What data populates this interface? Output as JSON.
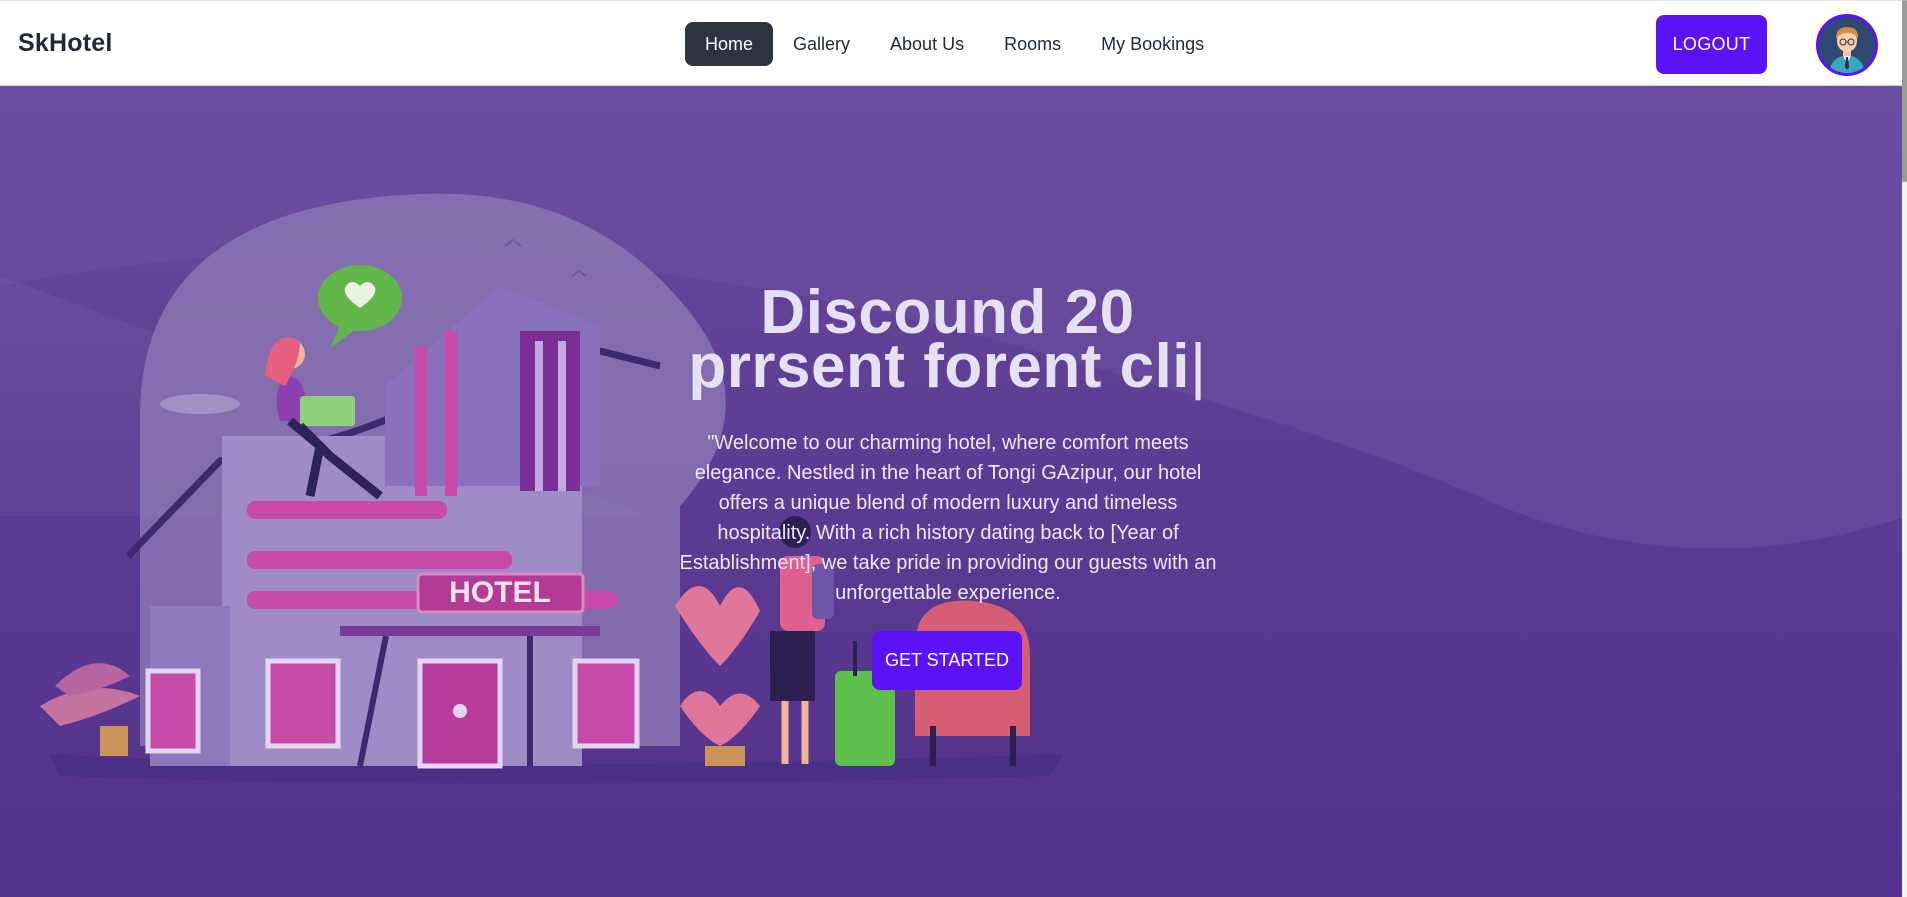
{
  "navbar": {
    "brand": "SkHotel",
    "items": [
      {
        "label": "Home",
        "active": true
      },
      {
        "label": "Gallery",
        "active": false
      },
      {
        "label": "About Us",
        "active": false
      },
      {
        "label": "Rooms",
        "active": false
      },
      {
        "label": "My Bookings",
        "active": false
      }
    ],
    "logout_label": "LOGOUT",
    "avatar_icon": "user-avatar-icon"
  },
  "hero": {
    "title_line1": "Discound 20",
    "title_line2": "prrsent forent cli",
    "caret": "|",
    "description": "\"Welcome to our charming hotel, where comfort meets elegance. Nestled in the heart of Tongi GAzipur, our hotel offers a unique blend of modern luxury and timeless hospitality. With a rich history dating back to [Year of Establishment], we take pride in providing our guests with an unforgettable experience.",
    "cta_label": "GET STARTED",
    "sign_text": "HOTEL"
  },
  "colors": {
    "accent": "#5b12f5",
    "active_nav": "#2b3440",
    "hero_bg": "#5d3c93"
  }
}
